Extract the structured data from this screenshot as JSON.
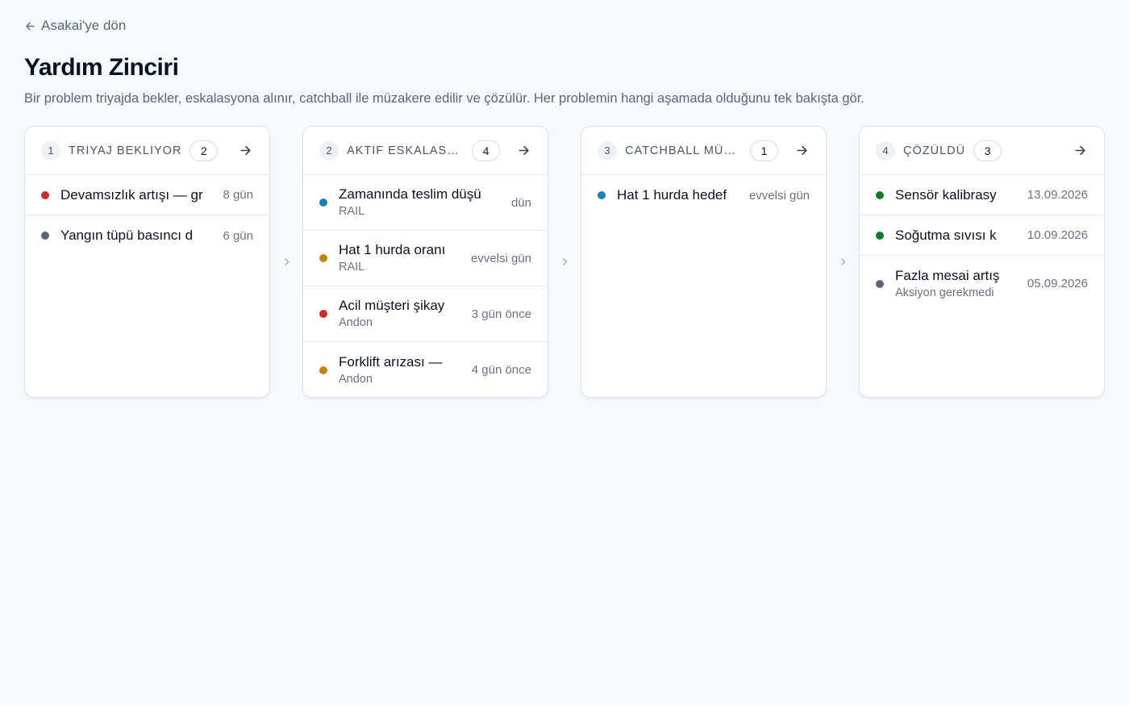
{
  "back_link": {
    "label": "Asakai'ye dön"
  },
  "title": "Yardım Zinciri",
  "description": "Bir problem triyajda bekler, eskalasyona alınır, catchball ile müzakere edilir ve çözülür. Her problemin hangi aşamada olduğunu tek bakışta gör.",
  "colors": {
    "red": "#c92a2a",
    "gray": "#5b6577",
    "blue": "#1c7fb8",
    "amber": "#c08512",
    "green": "#0f7a2e"
  },
  "columns": [
    {
      "number": "1",
      "title": "TRİYAJ BEKLİYOR",
      "count": "2",
      "items": [
        {
          "title": "Devamsızlık artışı — gr",
          "sub": "",
          "time": "8 gün",
          "color": "#c92a2a"
        },
        {
          "title": "Yangın tüpü basıncı d",
          "sub": "",
          "time": "6 gün",
          "color": "#5b6577"
        }
      ]
    },
    {
      "number": "2",
      "title": "AKTİF ESKALASYON",
      "count": "4",
      "items": [
        {
          "title": "Zamanında teslim düşü",
          "sub": "RAIL",
          "time": "dün",
          "color": "#1c7fb8"
        },
        {
          "title": "Hat 1 hurda oranı",
          "sub": "RAIL",
          "time": "evvelsi gün",
          "color": "#c08512"
        },
        {
          "title": "Acil müşteri şikay",
          "sub": "Andon",
          "time": "3 gün önce",
          "color": "#c92a2a"
        },
        {
          "title": "Forklift arızası —",
          "sub": "Andon",
          "time": "4 gün önce",
          "color": "#c08512"
        }
      ]
    },
    {
      "number": "3",
      "title": "CATCHBALL MÜZAKERE",
      "count": "1",
      "items": [
        {
          "title": "Hat 1 hurda hedef",
          "sub": "",
          "time": "evvelsi gün",
          "color": "#1c7fb8"
        }
      ]
    },
    {
      "number": "4",
      "title": "ÇÖZÜLDÜ",
      "count": "3",
      "items": [
        {
          "title": "Sensör kalibrasy",
          "sub": "",
          "time": "13.09.2026",
          "color": "#0f7a2e"
        },
        {
          "title": "Soğutma sıvısı k",
          "sub": "",
          "time": "10.09.2026",
          "color": "#0f7a2e"
        },
        {
          "title": "Fazla mesai artış",
          "sub": "Aksiyon gerekmedi",
          "time": "05.09.2026",
          "color": "#5b6577"
        }
      ]
    }
  ]
}
